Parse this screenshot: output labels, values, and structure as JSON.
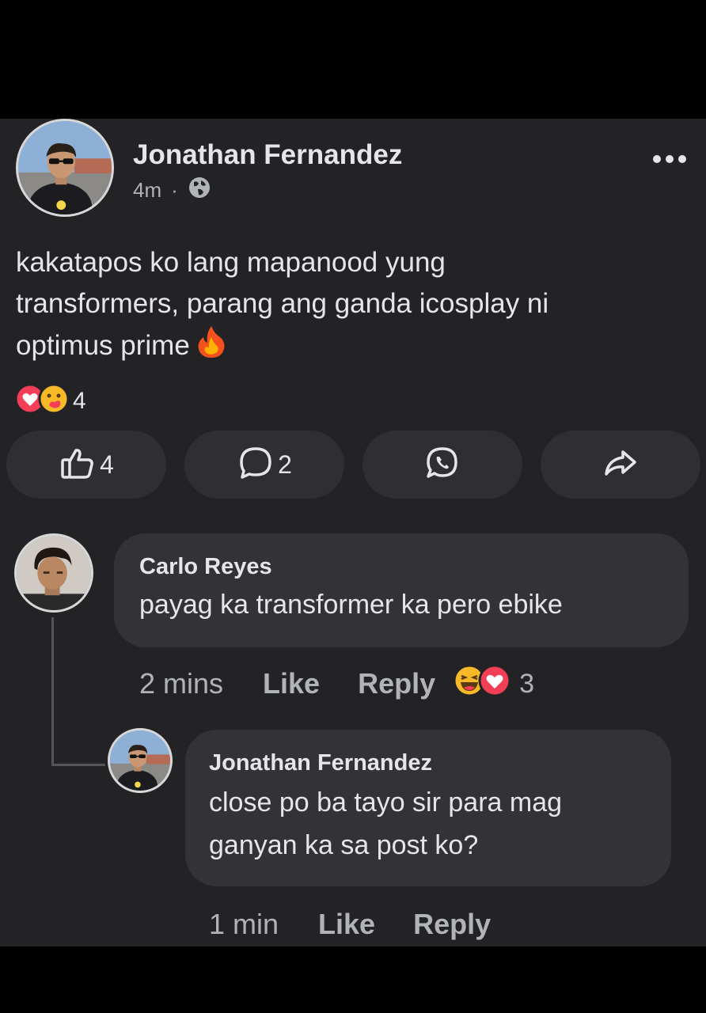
{
  "post": {
    "author": "Jonathan Fernandez",
    "time": "4m",
    "separator": "·",
    "audience_icon": "globe-icon",
    "text_lines": [
      "kakatapos ko lang mapanood yung",
      "transformers, parang ang ganda icosplay ni",
      "optimus prime"
    ],
    "emoji": "fire-emoji",
    "reactions": {
      "types": [
        "love",
        "care"
      ],
      "count": "4"
    }
  },
  "actions": {
    "like": {
      "icon": "thumbs-up-icon",
      "count": "4"
    },
    "comment": {
      "icon": "comment-icon",
      "count": "2"
    },
    "whatsapp": {
      "icon": "whatsapp-icon"
    },
    "share": {
      "icon": "share-icon"
    }
  },
  "comments": [
    {
      "author": "Carlo Reyes",
      "text": "payag ka transformer ka pero ebike",
      "time": "2 mins",
      "like_label": "Like",
      "reply_label": "Reply",
      "reactions": {
        "types": [
          "haha",
          "love"
        ],
        "count": "3"
      }
    }
  ],
  "replies": [
    {
      "author": "Jonathan Fernandez",
      "text_lines": [
        "close po ba tayo sir para mag",
        "ganyan ka sa post ko?"
      ],
      "time": "1 min",
      "like_label": "Like",
      "reply_label": "Reply"
    }
  ],
  "colors": {
    "background": "#000000",
    "card": "#232325",
    "button": "#2f2f31",
    "bubble": "#333335",
    "text": "#e4e6eb",
    "muted": "#b0b3b8",
    "love_red": "#f33e58",
    "haha_yellow": "#f7b928"
  }
}
